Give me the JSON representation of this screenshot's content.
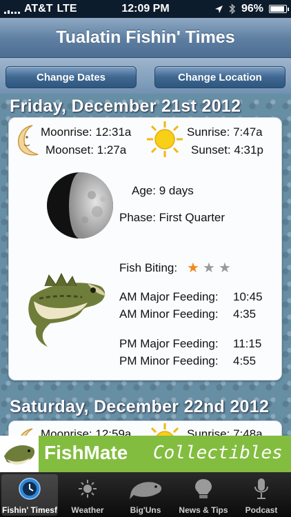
{
  "status_bar": {
    "carrier": "AT&T",
    "network": "LTE",
    "time": "12:09 PM",
    "battery": "96%",
    "battery_level": 0.96
  },
  "navbar": {
    "title": "Tualatin Fishin' Times"
  },
  "toolbar": {
    "change_dates": "Change Dates",
    "change_location": "Change Location"
  },
  "days": [
    {
      "title": "Friday, December 21st 2012",
      "moonrise": "Moonrise: 12:31a",
      "moonset": "Moonset: 1:27a",
      "sunrise": "Sunrise: 7:47a",
      "sunset": "Sunset: 4:31p",
      "age": "Age: 9 days",
      "phase": "Phase: First Quarter",
      "fish_biting_label": "Fish Biting:",
      "fish_biting_rating": 1,
      "fish_biting_max": 3,
      "am_major_label": "AM Major Feeding:",
      "am_major_time": "10:45",
      "am_minor_label": "AM Minor Feeding:",
      "am_minor_time": "4:35",
      "pm_major_label": "PM Major Feeding:",
      "pm_major_time": "11:15",
      "pm_minor_label": "PM Minor Feeding:",
      "pm_minor_time": "4:55"
    },
    {
      "title": "Saturday, December 22nd 2012",
      "moonrise": "Moonrise: 12:59a",
      "sunrise": "Sunrise: 7:48a"
    }
  ],
  "ad": {
    "brand": "FishMate",
    "tagline": "Collectibles"
  },
  "tabs": [
    {
      "label": "Fishin' Timesf",
      "icon": "clock-icon",
      "active": true
    },
    {
      "label": "Weather",
      "icon": "sun-icon",
      "active": false
    },
    {
      "label": "Big'Uns",
      "icon": "fish-icon",
      "active": false
    },
    {
      "label": "News & Tips",
      "icon": "lightbulb-icon",
      "active": false
    },
    {
      "label": "Podcast",
      "icon": "microphone-icon",
      "active": false
    }
  ],
  "colors": {
    "star_on": "#f08a1c",
    "star_off": "#9a9a9a",
    "ad_green": "#82bd3f",
    "nav_blue": "#5d7ea1"
  }
}
